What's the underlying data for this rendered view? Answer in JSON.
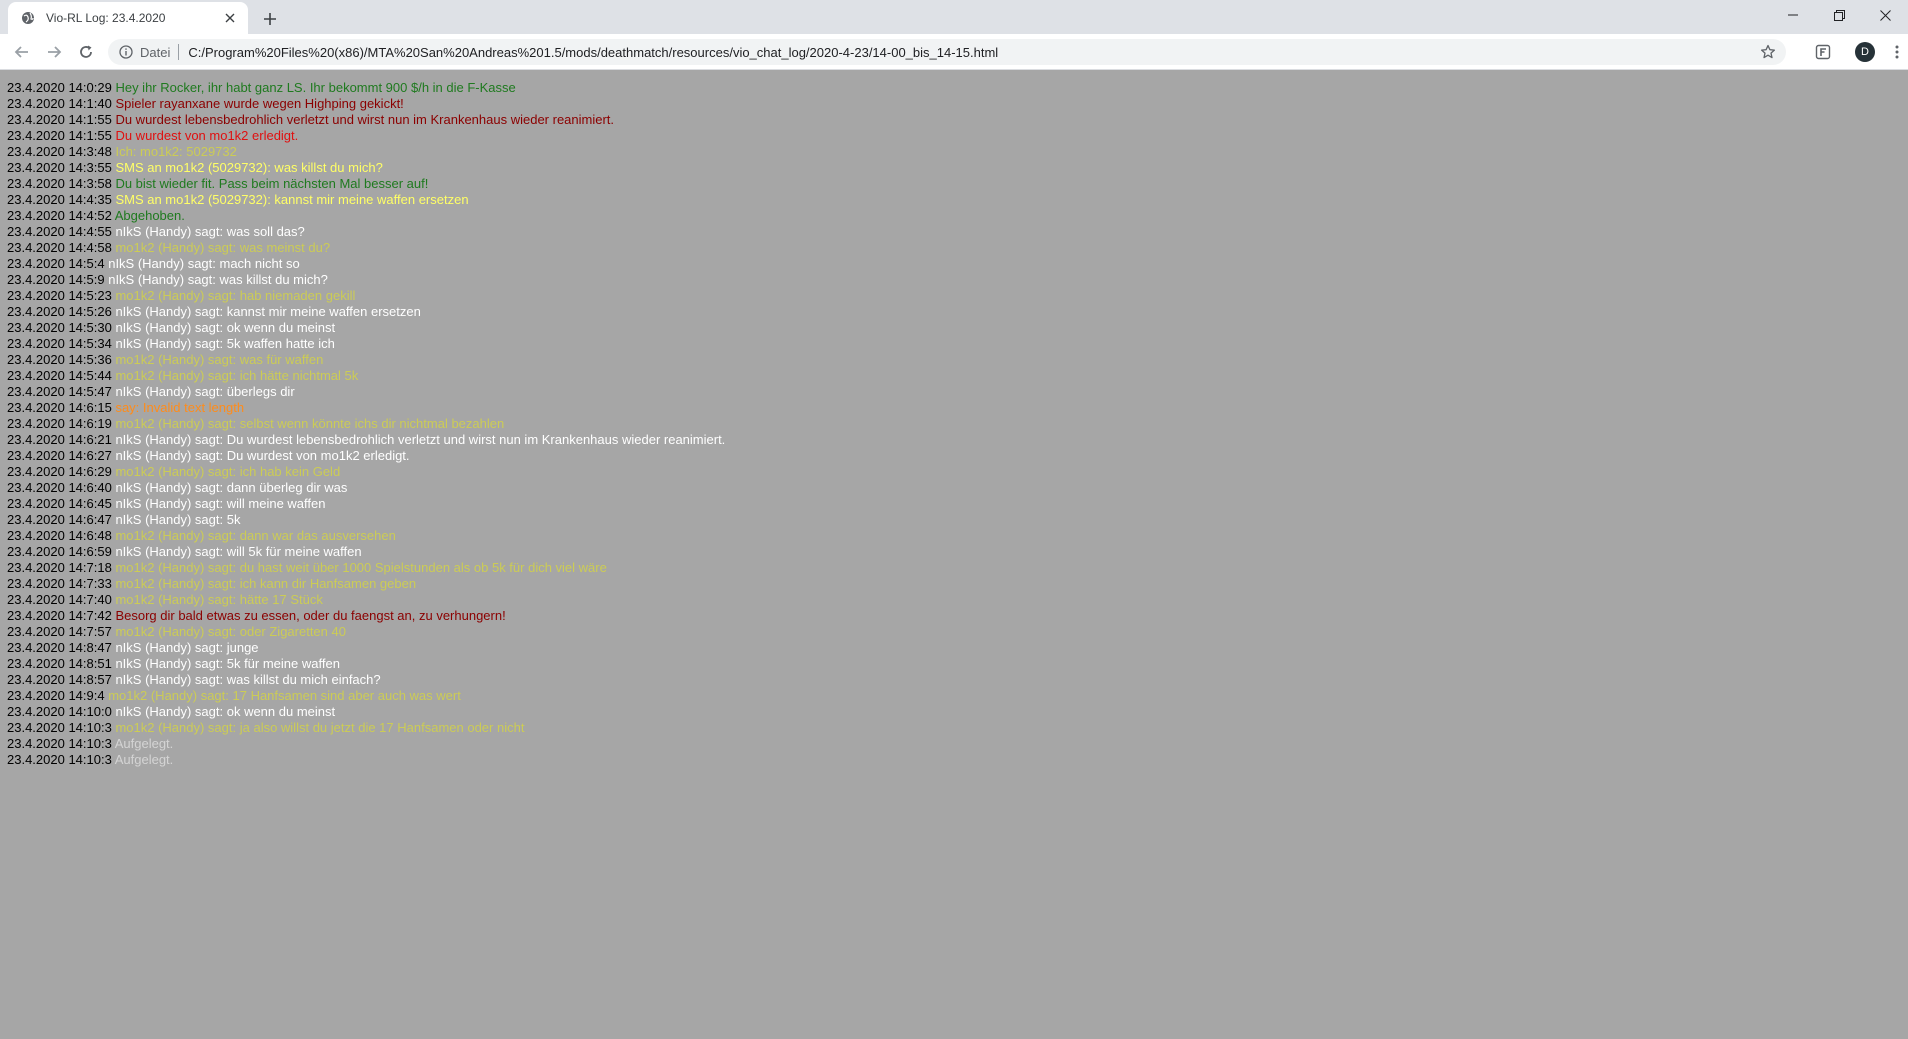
{
  "browser": {
    "tab_title": "Vio-RL Log: 23.4.2020",
    "scheme_label": "Datei",
    "url": "C:/Program%20Files%20(x86)/MTA%20San%20Andreas%201.5/mods/deathmatch/resources/vio_chat_log/2020-4-23/14-00_bis_14-15.html",
    "avatar_letter": "D"
  },
  "colors": {
    "page_background": "#a6a6a6",
    "timestamp": "#000000",
    "green": "#1f7a1f",
    "dark_red": "#8b0000",
    "red": "#e01010",
    "yellow": "#ffff66",
    "white": "#ffffff",
    "olive": "#cccc55",
    "orange": "#ff8c1a",
    "light_gray": "#d4d4d4"
  },
  "log": [
    {
      "ts": "23.4.2020 14:0:29",
      "msg": "Hey ihr Rocker, ihr habt ganz LS. Ihr bekommt 900 $/h in die F-Kasse",
      "color": "#1f7a1f"
    },
    {
      "ts": "23.4.2020 14:1:40",
      "msg": "Spieler rayanxane wurde wegen Highping gekickt!",
      "color": "#8b0000"
    },
    {
      "ts": "23.4.2020 14:1:55",
      "msg": "Du wurdest lebensbedrohlich verletzt und wirst nun im Krankenhaus wieder reanimiert.",
      "color": "#8b0000"
    },
    {
      "ts": "23.4.2020 14:1:55",
      "msg": "Du wurdest von mo1k2 erledigt.",
      "color": "#e01010"
    },
    {
      "ts": "23.4.2020 14:3:48",
      "msg": "Ich: mo1k2: 5029732",
      "color": "#cccc55"
    },
    {
      "ts": "23.4.2020 14:3:55",
      "msg": "SMS an mo1k2 (5029732): was killst du mich?",
      "color": "#ffff66"
    },
    {
      "ts": "23.4.2020 14:3:58",
      "msg": "Du bist wieder fit. Pass beim nächsten Mal besser auf!",
      "color": "#1f7a1f"
    },
    {
      "ts": "23.4.2020 14:4:35",
      "msg": "SMS an mo1k2 (5029732): kannst mir meine waffen ersetzen",
      "color": "#ffff66"
    },
    {
      "ts": "23.4.2020 14:4:52",
      "msg": "Abgehoben.",
      "color": "#1f7a1f"
    },
    {
      "ts": "23.4.2020 14:4:55",
      "msg": "nIkS (Handy) sagt: was soll das?",
      "color": "#ffffff"
    },
    {
      "ts": "23.4.2020 14:4:58",
      "msg": "mo1k2 (Handy) sagt: was meinst du?",
      "color": "#cccc55"
    },
    {
      "ts": "23.4.2020 14:5:4",
      "msg": "nIkS (Handy) sagt: mach nicht so",
      "color": "#ffffff"
    },
    {
      "ts": "23.4.2020 14:5:9",
      "msg": "nIkS (Handy) sagt: was killst du mich?",
      "color": "#ffffff"
    },
    {
      "ts": "23.4.2020 14:5:23",
      "msg": "mo1k2 (Handy) sagt: hab niemaden gekill",
      "color": "#cccc55"
    },
    {
      "ts": "23.4.2020 14:5:26",
      "msg": "nIkS (Handy) sagt: kannst mir meine waffen ersetzen",
      "color": "#ffffff"
    },
    {
      "ts": "23.4.2020 14:5:30",
      "msg": "nIkS (Handy) sagt: ok wenn du meinst",
      "color": "#ffffff"
    },
    {
      "ts": "23.4.2020 14:5:34",
      "msg": "nIkS (Handy) sagt: 5k waffen hatte ich",
      "color": "#ffffff"
    },
    {
      "ts": "23.4.2020 14:5:36",
      "msg": "mo1k2 (Handy) sagt: was für waffen",
      "color": "#cccc55"
    },
    {
      "ts": "23.4.2020 14:5:44",
      "msg": "mo1k2 (Handy) sagt: ich hätte nichtmal 5k",
      "color": "#cccc55"
    },
    {
      "ts": "23.4.2020 14:5:47",
      "msg": "nIkS (Handy) sagt: überlegs dir",
      "color": "#ffffff"
    },
    {
      "ts": "23.4.2020 14:6:15",
      "msg": "say: Invalid text length",
      "color": "#ff8c1a"
    },
    {
      "ts": "23.4.2020 14:6:19",
      "msg": "mo1k2 (Handy) sagt: selbst wenn könnte ichs dir nichtmal bezahlen",
      "color": "#cccc55"
    },
    {
      "ts": "23.4.2020 14:6:21",
      "msg": "nIkS (Handy) sagt: Du wurdest lebensbedrohlich verletzt und wirst nun im Krankenhaus wieder reanimiert.",
      "color": "#ffffff"
    },
    {
      "ts": "23.4.2020 14:6:27",
      "msg": "nIkS (Handy) sagt: Du wurdest von mo1k2 erledigt.",
      "color": "#ffffff"
    },
    {
      "ts": "23.4.2020 14:6:29",
      "msg": "mo1k2 (Handy) sagt: ich hab kein Geld",
      "color": "#cccc55"
    },
    {
      "ts": "23.4.2020 14:6:40",
      "msg": "nIkS (Handy) sagt: dann überleg dir was",
      "color": "#ffffff"
    },
    {
      "ts": "23.4.2020 14:6:45",
      "msg": "nIkS (Handy) sagt: will meine waffen",
      "color": "#ffffff"
    },
    {
      "ts": "23.4.2020 14:6:47",
      "msg": "nIkS (Handy) sagt: 5k",
      "color": "#ffffff"
    },
    {
      "ts": "23.4.2020 14:6:48",
      "msg": "mo1k2 (Handy) sagt: dann war das ausversehen",
      "color": "#cccc55"
    },
    {
      "ts": "23.4.2020 14:6:59",
      "msg": "nIkS (Handy) sagt: will 5k für meine waffen",
      "color": "#ffffff"
    },
    {
      "ts": "23.4.2020 14:7:18",
      "msg": "mo1k2 (Handy) sagt: du hast weit über 1000 Spielstunden als ob 5k für dich viel wäre",
      "color": "#cccc55"
    },
    {
      "ts": "23.4.2020 14:7:33",
      "msg": "mo1k2 (Handy) sagt: ich kann dir Hanfsamen geben",
      "color": "#cccc55"
    },
    {
      "ts": "23.4.2020 14:7:40",
      "msg": "mo1k2 (Handy) sagt: hätte 17 Stück",
      "color": "#cccc55"
    },
    {
      "ts": "23.4.2020 14:7:42",
      "msg": "Besorg dir bald etwas zu essen, oder du faengst an, zu verhungern!",
      "color": "#8b0000"
    },
    {
      "ts": "23.4.2020 14:7:57",
      "msg": "mo1k2 (Handy) sagt: oder Zigaretten 40",
      "color": "#cccc55"
    },
    {
      "ts": "23.4.2020 14:8:47",
      "msg": "nIkS (Handy) sagt: junge",
      "color": "#ffffff"
    },
    {
      "ts": "23.4.2020 14:8:51",
      "msg": "nIkS (Handy) sagt: 5k für meine waffen",
      "color": "#ffffff"
    },
    {
      "ts": "23.4.2020 14:8:57",
      "msg": "nIkS (Handy) sagt: was killst du mich einfach?",
      "color": "#ffffff"
    },
    {
      "ts": "23.4.2020 14:9:4",
      "msg": "mo1k2 (Handy) sagt: 17 Hanfsamen sind aber auch was wert",
      "color": "#cccc55"
    },
    {
      "ts": "23.4.2020 14:10:0",
      "msg": "nIkS (Handy) sagt: ok wenn du meinst",
      "color": "#ffffff"
    },
    {
      "ts": "23.4.2020 14:10:3",
      "msg": "mo1k2 (Handy) sagt: ja also willst du jetzt die 17 Hanfsamen oder nicht",
      "color": "#cccc55"
    },
    {
      "ts": "23.4.2020 14:10:3",
      "msg": "Aufgelegt.",
      "color": "#d4d4d4"
    },
    {
      "ts": "23.4.2020 14:10:3",
      "msg": "Aufgelegt.",
      "color": "#d4d4d4"
    }
  ]
}
